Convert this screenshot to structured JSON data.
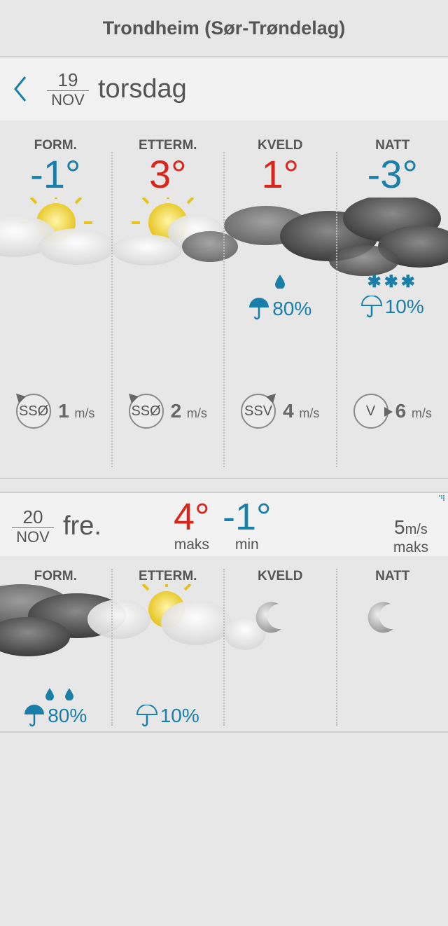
{
  "location_title": "Trondheim (Sør-Trøndelag)",
  "day1": {
    "day": "19",
    "month": "NOV",
    "weekday": "torsdag",
    "periods": [
      {
        "label": "FORM.",
        "temp": "-1°",
        "temp_color": "#1a7fa8",
        "icon": "sun-cloud-icon",
        "precip_icon": "",
        "precip": "",
        "wind_dir": "SSØ",
        "wind_speed": "1",
        "wind_unit": "m/s"
      },
      {
        "label": "ETTERM.",
        "temp": "3°",
        "temp_color": "#d9261c",
        "icon": "sun-cloud-icon",
        "precip_icon": "",
        "precip": "",
        "wind_dir": "SSØ",
        "wind_speed": "2",
        "wind_unit": "m/s"
      },
      {
        "label": "KVELD",
        "temp": "1°",
        "temp_color": "#d9261c",
        "icon": "rain-cloud-icon",
        "precip_icon": "raindrop-icon",
        "precip": "80%",
        "wind_dir": "SSV",
        "wind_speed": "4",
        "wind_unit": "m/s"
      },
      {
        "label": "NATT",
        "temp": "-3°",
        "temp_color": "#1a7fa8",
        "icon": "snow-cloud-icon",
        "precip_icon": "snowflake-icon",
        "precip": "10%",
        "wind_dir": "V",
        "wind_speed": "6",
        "wind_unit": "m/s"
      }
    ]
  },
  "day2": {
    "day": "20",
    "month": "NOV",
    "weekday": "fre.",
    "max_temp": "4°",
    "min_temp": "-1°",
    "max_label": "maks",
    "min_label": "min",
    "wind_speed": "5",
    "wind_unit": "m/s",
    "wind_label": "maks",
    "periods": [
      {
        "label": "FORM.",
        "icon": "rain-cloud-icon",
        "precip": "80%"
      },
      {
        "label": "ETTERM.",
        "icon": "sun-cloud-icon",
        "precip": "10%"
      },
      {
        "label": "KVELD",
        "icon": "moon-icon",
        "precip": ""
      },
      {
        "label": "NATT",
        "icon": "moon-icon",
        "precip": ""
      }
    ]
  },
  "colors": {
    "cold": "#1a7fa8",
    "warm": "#d9261c"
  }
}
